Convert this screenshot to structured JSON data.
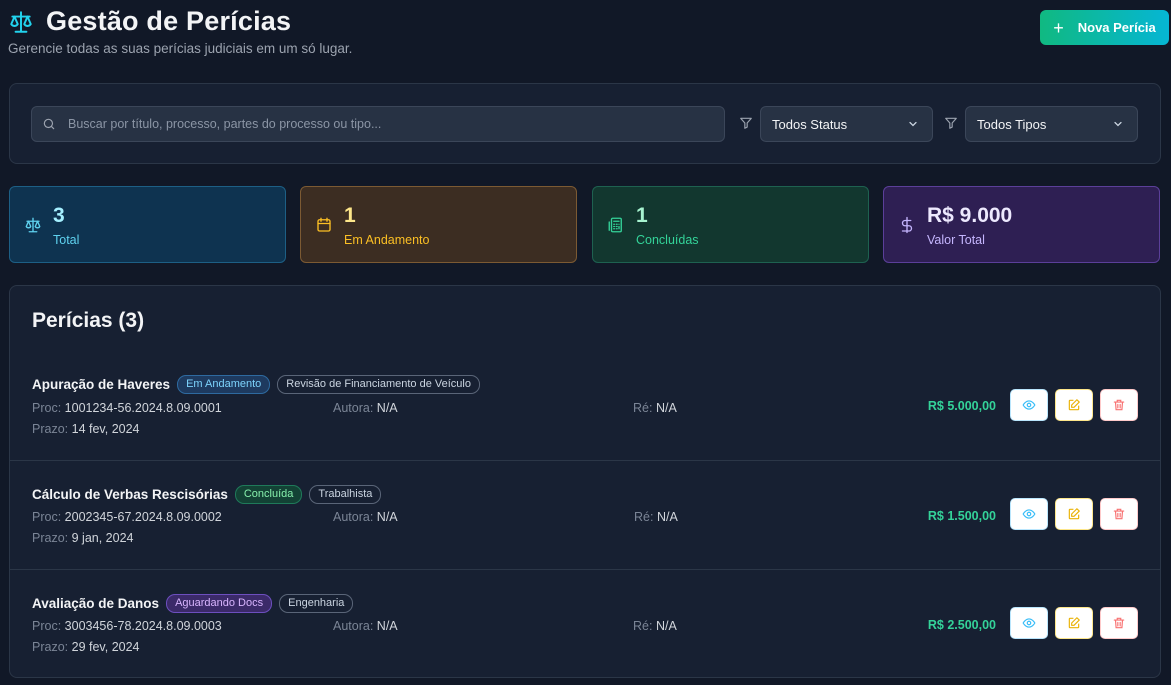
{
  "header": {
    "title": "Gestão de Perícias",
    "subtitle": "Gerencie todas as suas perícias judiciais em um só lugar.",
    "new_button_label": "Nova Perícia",
    "title_icon": "scale-icon"
  },
  "filters": {
    "search_placeholder": "Buscar por título, processo, partes do processo ou tipo...",
    "status_value": "Todos Status",
    "type_value": "Todos Tipos"
  },
  "stats": [
    {
      "value": "3",
      "label": "Total",
      "icon": "scale-icon"
    },
    {
      "value": "1",
      "label": "Em Andamento",
      "icon": "calendar-icon"
    },
    {
      "value": "1",
      "label": "Concluídas",
      "icon": "calculator-icon"
    },
    {
      "value": "R$ 9.000",
      "label": "Valor Total",
      "icon": "dollar-icon"
    }
  ],
  "list": {
    "title": "Perícias (3)",
    "proc_key": "Proc:",
    "autora_key": "Autora:",
    "re_key": "Ré:",
    "prazo_key": "Prazo:",
    "rows": [
      {
        "title": "Apuração de Haveres",
        "status": "Em Andamento",
        "type": "Revisão de Financiamento de Veículo",
        "proc": "1001234-56.2024.8.09.0001",
        "autora": "N/A",
        "re": "N/A",
        "prazo": "14 fev, 2024",
        "amount": "R$ 5.000,00"
      },
      {
        "title": "Cálculo de Verbas Rescisórias",
        "status": "Concluída",
        "type": "Trabalhista",
        "proc": "2002345-67.2024.8.09.0002",
        "autora": "N/A",
        "re": "N/A",
        "prazo": "9 jan, 2024",
        "amount": "R$ 1.500,00"
      },
      {
        "title": "Avaliação de Danos",
        "status": "Aguardando Docs",
        "type": "Engenharia",
        "proc": "3003456-78.2024.8.09.0003",
        "autora": "N/A",
        "re": "N/A",
        "prazo": "29 fev, 2024",
        "amount": "R$ 2.500,00"
      }
    ]
  },
  "colors": {
    "background": "#111827",
    "accent_green": "#10b981",
    "accent_cyan": "#06b6d4",
    "amount_green": "#34d399"
  }
}
